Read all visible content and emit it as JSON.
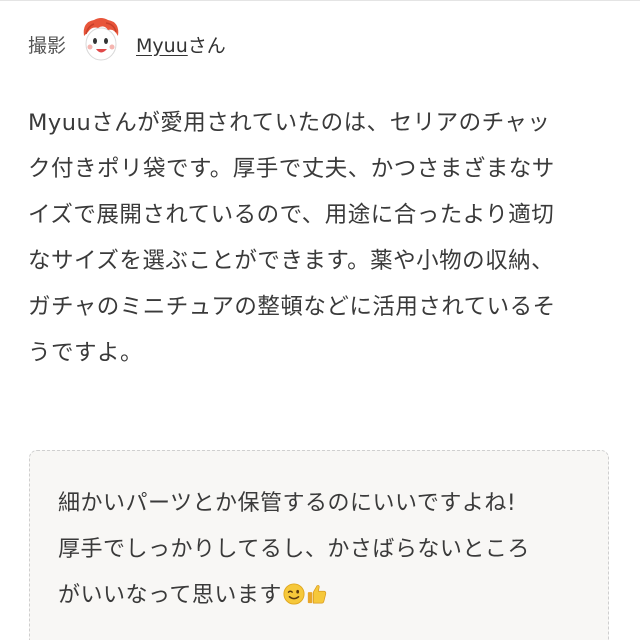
{
  "credit": {
    "label": "撮影",
    "author_name": "Myuu",
    "author_suffix": "さん"
  },
  "article": {
    "paragraph_lines": [
      "Myuuさんが愛用されていたのは、セリアのチャッ",
      "ク付きポリ袋です。厚手で丈夫、かつさまざまなサ",
      "イズで展開されているので、用途に合ったより適切",
      "なサイズを選ぶことができます。薬や小物の収納、",
      "ガチャのミニチュアの整頓などに活用されているそ",
      "うですよ。"
    ]
  },
  "comment": {
    "lines": [
      "細かいパーツとか保管するのにいいですよね!",
      "厚手でしっかりしてるし、かさばらないところ",
      "がいいなって思います"
    ],
    "emojis": [
      "wink-face-icon",
      "thumbs-up-icon"
    ]
  },
  "colors": {
    "text": "#3a3a3a",
    "comment_bg": "#f8f7f5",
    "comment_border": "#cfcfcf",
    "avatar_hair": "#e8553a"
  }
}
